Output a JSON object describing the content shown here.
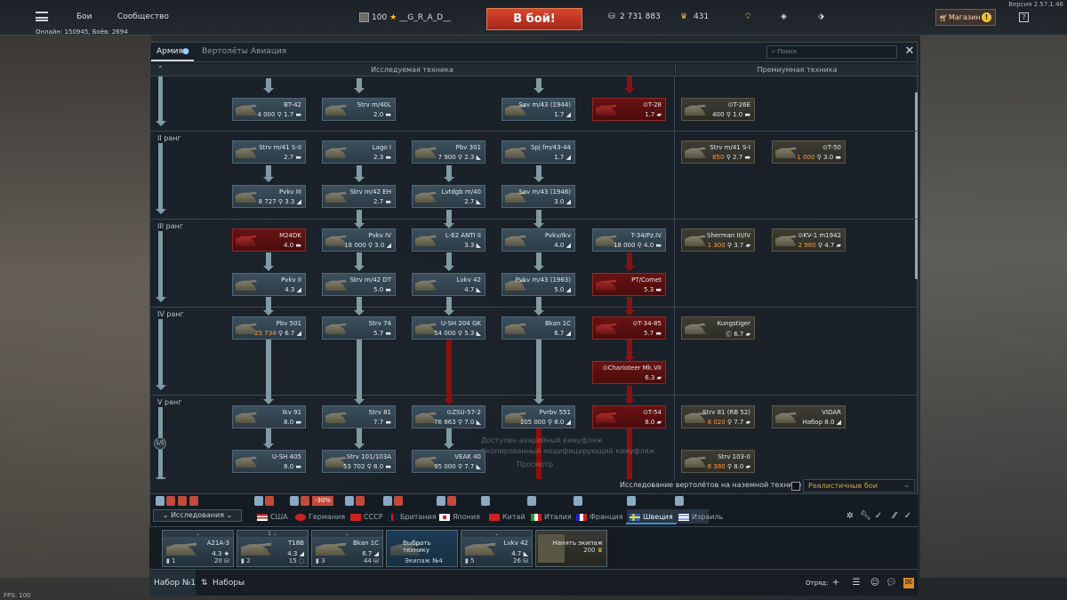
{
  "topbar": {
    "nav": [
      "Бои",
      "Сообщество"
    ],
    "online": "Онлайн: 150945, Боёв: 2694",
    "version": "Версия 2.57.1.46",
    "player_level": "100",
    "player_name": "__G_R_A_D__",
    "to_battle": "В бой!",
    "silver_lions": "2 731 883",
    "research_points": "431",
    "shop": "Магазин",
    "shop_badge": "!",
    "help": "?"
  },
  "tabs": [
    "Армия",
    "Вертолёты",
    "Авиация"
  ],
  "search_placeholder": "Поиск",
  "headers": {
    "researchable": "Исследуемая техника",
    "premium": "Премиумная техника"
  },
  "ranks": [
    "II ранг",
    "III ранг",
    "IV ранг",
    "V ранг"
  ],
  "rank_progress": "1/5",
  "vehicles": [
    {
      "name": "BT-42",
      "stats": "4 000 ⚲ 1.7 ▬"
    },
    {
      "name": "Strv m/40L",
      "stats": "2.0 ▬"
    },
    {
      "name": "Sav m/43 (1944)",
      "stats": "1.7 ◢"
    },
    {
      "name": "⊙T-28",
      "stats": "1.7 ▰"
    },
    {
      "name": "⊙T-26E",
      "stats_a": "400",
      "stats_b": " ⚲ 1.0 ▬"
    },
    {
      "name": "Strv m/41 S-II",
      "stats": "2.7 ▬"
    },
    {
      "name": "Lago I",
      "stats": "2.3 ▬"
    },
    {
      "name": "Pbv 301",
      "stats": "7 900 ⚲ 2.3 ◣"
    },
    {
      "name": "Spj fm/43-44",
      "stats": "1.7 ◢"
    },
    {
      "name": "Strv m/41 S-I",
      "stats_a": "850",
      "stats_b": " ⚲ 2.7 ▬"
    },
    {
      "name": "⊙T-50",
      "stats_a": "1 000",
      "stats_b": " ⚲ 3.0 ▬"
    },
    {
      "name": "Pvkv III",
      "stats": "8 727 ⚲ 3.3 ◢"
    },
    {
      "name": "Strv m/42 EH",
      "stats": "2.7 ▬"
    },
    {
      "name": "Lvtdgb m/40",
      "stats": "2.7 ◣"
    },
    {
      "name": "Sav m/43 (1946)",
      "stats": "3.0 ◢"
    },
    {
      "name": "M24DK",
      "stats": "4.0 ▬"
    },
    {
      "name": "Pvkv IV",
      "stats": "18 000 ⚲ 3.0 ◢"
    },
    {
      "name": "L-62 ANTI II",
      "stats": "3.3 ◣"
    },
    {
      "name": "Pvkv/Ikv",
      "stats": "4.0 ◢"
    },
    {
      "name": "T-34/Pz.IV",
      "stats": "18 000 ⚲ 4.0 ▬"
    },
    {
      "name": "Sherman III/IV",
      "stats_a": "1 300",
      "stats_b": " ⚲ 3.7 ▰"
    },
    {
      "name": "⊙KV-1 m1942",
      "stats_a": "2 980",
      "stats_b": " ⚲ 4.7 ▰"
    },
    {
      "name": "Pvkv II",
      "stats": "4.3 ◢"
    },
    {
      "name": "Strv m/42 DT",
      "stats": "5.0 ▬"
    },
    {
      "name": "Lvkv 42",
      "stats": "4.7 ◣"
    },
    {
      "name": "Pvkv m/43 (1963)",
      "stats": "5.0 ◢"
    },
    {
      "name": "PT/Comet",
      "stats": "5.3 ▬"
    },
    {
      "name": "Pbv 501",
      "stats_a": "25 734",
      "stats_b": " ⚲ 6.7 ◢"
    },
    {
      "name": "Strv 74",
      "stats": "5.7 ▬"
    },
    {
      "name": "U-SH 204 GK",
      "stats": "54 000 ⚲ 5.3 ◣"
    },
    {
      "name": "Bkan 1C",
      "stats": "6.7 ◢"
    },
    {
      "name": "⊙T-34-85",
      "stats": "5.7 ▬"
    },
    {
      "name": "Kungstiger",
      "stats": "Ⓒ 6.7 ▰"
    },
    {
      "name": "⊙Charioteer Mk.VII",
      "stats": "6.3 ▰"
    },
    {
      "name": "Ikv 91",
      "stats": "8.0 ▬"
    },
    {
      "name": "Strv 81",
      "stats": "7.7 ▬"
    },
    {
      "name": "⊙ZSU-57-2",
      "stats": "76 863 ⚲ 7.0 ◣"
    },
    {
      "name": "Pvrbv 551",
      "stats": "105 000 ⚲ 8.0 ◢"
    },
    {
      "name": "⊙T-54",
      "stats": "8.0 ▰"
    },
    {
      "name": "Strv 81 (RB 52)",
      "stats_a": "8 020",
      "stats_b": " ⚲ 7.7 ▰"
    },
    {
      "name": "VIDAR",
      "stats": "Набор 8.0 ◢"
    },
    {
      "name": "U-SH 405",
      "stats": "8.0 ▬"
    },
    {
      "name": "Strv 101/103A",
      "stats": "53 702 ⚲ 8.0 ▬"
    },
    {
      "name": "VEAK 40",
      "stats": "95 000 ⚲ 7.7 ◣"
    },
    {
      "name": "Strv 103-0",
      "stats_a": "8 380",
      "stats_b": " ⚲ 8.0 ▰"
    }
  ],
  "bg_texts": [
    "Доступен аварийный камуфляж",
    "Скопированный модифицирующий камуфляж",
    "Просмотр"
  ],
  "heli_research": "Исследование вертолётов на наземной технике",
  "mode_select": "Реалистичные бои",
  "research_tab": "Исследования",
  "discount": "-30%",
  "nations": [
    "США",
    "Германия",
    "СССР",
    "Британия",
    "Япония",
    "Китай",
    "Италия",
    "Франция",
    "Швеция",
    "Израиль"
  ],
  "slots": [
    {
      "name": "A21A-3",
      "br": "4.3",
      "idx": "1",
      "cost": "20"
    },
    {
      "name": "T18B",
      "br": "4.3",
      "idx": "2",
      "cost": "15"
    },
    {
      "name": "Bkan 1C",
      "br": "6.7",
      "idx": "3",
      "cost": "44"
    },
    {
      "name": "Выбрать технику",
      "sub": "Экипаж №4"
    },
    {
      "name": "Lvkv 42",
      "br": "4.7",
      "idx": "5",
      "cost": "26"
    },
    {
      "name": "Нанять экипаж",
      "cost": "200"
    }
  ],
  "footer": {
    "preset": "Набор №1",
    "presets": "Наборы",
    "squad": "Отряд:"
  },
  "fps": "FPS: 100",
  "colors": {
    "accent": "#3b8fc9",
    "battle": "#c9341f",
    "premium_text": "#ff9a3a"
  }
}
